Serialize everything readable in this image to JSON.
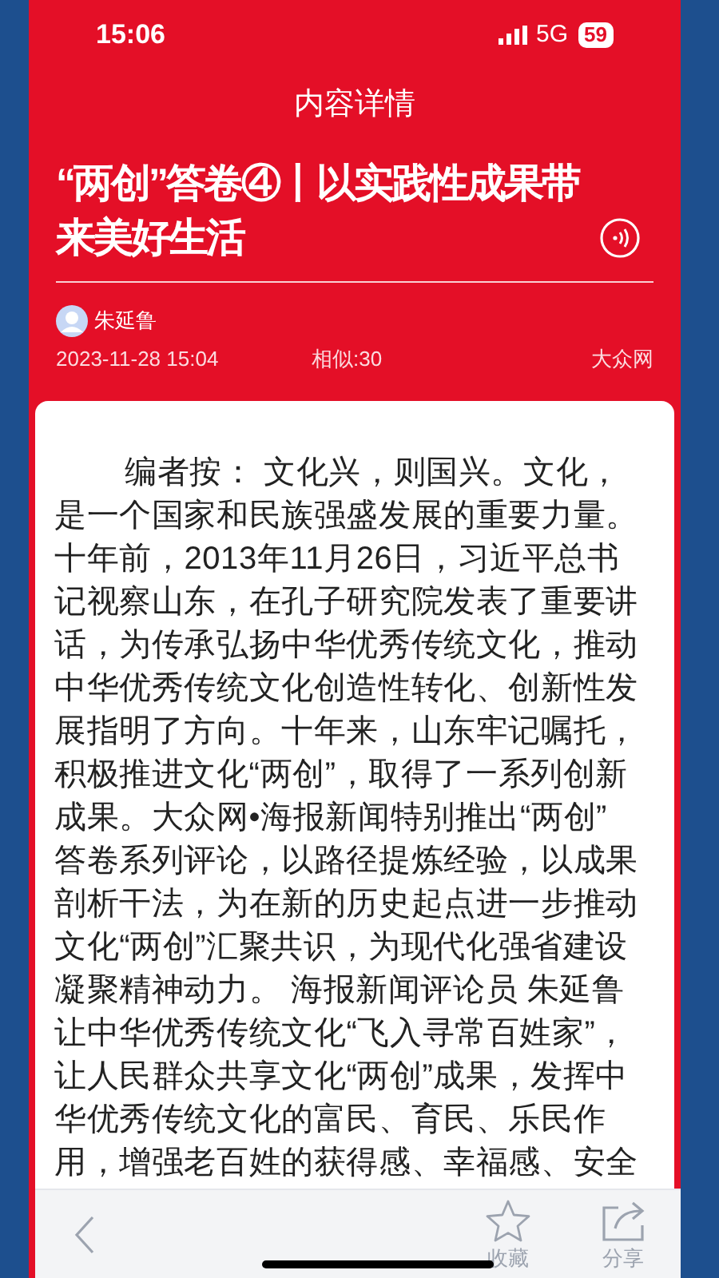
{
  "status_bar": {
    "time": "15:06",
    "network": "5G",
    "battery": "59"
  },
  "header": {
    "title": "内容详情"
  },
  "article": {
    "title": "“两创”答卷④丨以实践性成果带来美好生活",
    "author": "朱延鲁",
    "date": "2023-11-28 15:04",
    "similar": "相似:30",
    "source": "大众网",
    "body_lines": [
      "编者按： 文化兴，则国兴。文化，",
      "是一个国家和民族强盛发展的重要力量。",
      "十年前，2013年11月26日，习近平总书",
      "记视察山东，在孔子研究院发表了重要讲",
      "话，为传承弘扬中华优秀传统文化，推动",
      "中华优秀传统文化创造性转化、创新性发",
      "展指明了方向。十年来，山东牢记嘱托，",
      "积极推进文化“两创”，取得了一系列创新",
      "成果。大众网•海报新闻特别推出“两创”",
      "答卷系列评论，以路径提炼经验，以成果",
      "剖析干法，为在新的历史起点进一步推动",
      "文化“两创”汇聚共识，为现代化强省建设",
      "凝聚精神动力。 海报新闻评论员 朱延鲁",
      "让中华优秀传统文化“飞入寻常百姓家”，",
      "让人民群众共享文化“两创”成果，发挥中",
      "华优秀传统文化的富民、育民、乐民作",
      "用，增强老百姓的获得感、幸福感、安全"
    ]
  },
  "toolbar": [
    {
      "kind": "back"
    },
    {
      "kind": "star",
      "label": "收藏"
    },
    {
      "kind": "share",
      "label": "分享"
    }
  ]
}
